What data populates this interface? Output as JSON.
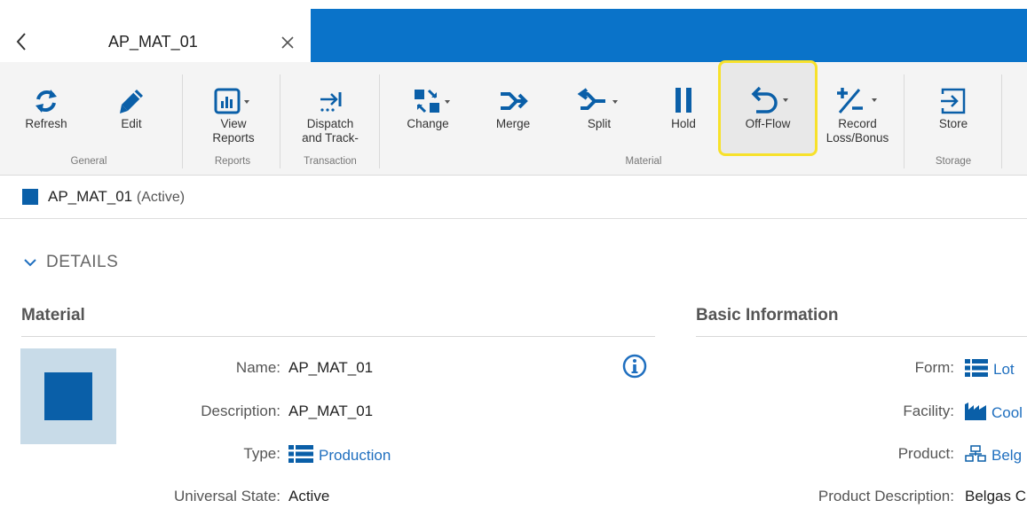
{
  "tab": {
    "title": "AP_MAT_01"
  },
  "ribbon": {
    "buttons": {
      "refresh": "Refresh",
      "edit": "Edit",
      "view_reports": "View\nReports",
      "dispatch": "Dispatch\nand Track-",
      "change": "Change",
      "merge": "Merge",
      "split": "Split",
      "hold": "Hold",
      "off_flow": "Off-Flow",
      "record": "Record\nLoss/Bonus",
      "store": "Store"
    },
    "groups": {
      "general": "General",
      "reports": "Reports",
      "transaction": "Transaction",
      "material": "Material",
      "storage": "Storage"
    }
  },
  "entity": {
    "name": "AP_MAT_01",
    "status": "(Active)"
  },
  "details": {
    "toggle_label": "DETAILS"
  },
  "material_section": {
    "title": "Material",
    "fields": {
      "name_label": "Name:",
      "name_value": "AP_MAT_01",
      "desc_label": "Description:",
      "desc_value": "AP_MAT_01",
      "type_label": "Type:",
      "type_value": "Production",
      "state_label": "Universal State:",
      "state_value": "Active"
    }
  },
  "basic_section": {
    "title": "Basic Information",
    "fields": {
      "form_label": "Form:",
      "form_value": "Lot",
      "facility_label": "Facility:",
      "facility_value": "Cool",
      "product_label": "Product:",
      "product_value": "Belg",
      "proddesc_label": "Product Description:",
      "proddesc_value": "Belgas C"
    }
  },
  "colors": {
    "accent": "#0a73c9",
    "highlight": "#f7e12a",
    "link": "#1f6fbf"
  }
}
